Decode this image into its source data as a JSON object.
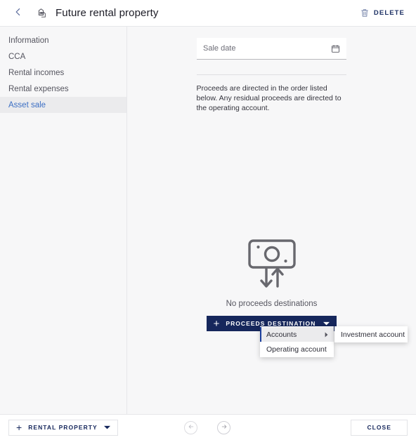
{
  "header": {
    "back_icon": "chevron-left-icon",
    "title_icon": "property-building-icon",
    "title": "Future rental property",
    "delete_icon": "trash-icon",
    "delete_label": "DELETE"
  },
  "sidebar": {
    "items": [
      {
        "label": "Information",
        "active": false
      },
      {
        "label": "CCA",
        "active": false
      },
      {
        "label": "Rental incomes",
        "active": false
      },
      {
        "label": "Rental expenses",
        "active": false
      },
      {
        "label": "Asset sale",
        "active": true
      }
    ]
  },
  "main": {
    "sale_date": {
      "label": "Sale date",
      "value": "",
      "placeholder": "Sale date",
      "icon": "calendar-icon"
    },
    "description": "Proceeds are directed in the order listed below. Any residual proceeds are directed to the operating account.",
    "empty_state": {
      "icon": "cash-transfer-icon",
      "label": "No proceeds destinations"
    },
    "add_button": {
      "plus": "+",
      "label": "PROCEEDS DESTINATION",
      "caret_icon": "chevron-down-icon"
    },
    "menu": {
      "items": [
        {
          "label": "Accounts",
          "has_submenu": true,
          "highlighted": true
        },
        {
          "label": "Operating account",
          "has_submenu": false,
          "highlighted": false
        }
      ],
      "submenu": {
        "items": [
          {
            "label": "Investment account"
          }
        ]
      }
    }
  },
  "footer": {
    "add_button": {
      "plus": "+",
      "label": "RENTAL PROPERTY",
      "caret_icon": "chevron-down-icon"
    },
    "prev_icon": "arrow-left-circle-icon",
    "next_icon": "arrow-right-circle-icon",
    "close_label": "CLOSE"
  },
  "colors": {
    "primary": "#16275c",
    "accent": "#3c6fc4",
    "menu_highlight_border": "#1c3f9c",
    "page_bg": "#f7f7f8",
    "surface": "#ffffff"
  }
}
